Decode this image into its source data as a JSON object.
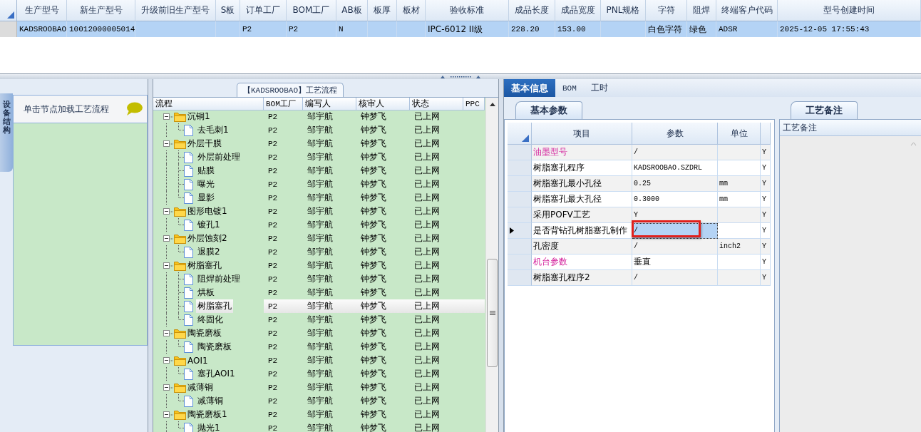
{
  "model_grid": {
    "columns": [
      "生产型号",
      "新生产型号",
      "升级前旧生产型号",
      "S板",
      "订单工厂",
      "BOM工厂",
      "AB板",
      "板厚",
      "板材",
      "验收标准",
      "成品长度",
      "成品宽度",
      "PNL规格",
      "字符",
      "阻焊",
      "终端客户代码",
      "型号创建时间"
    ],
    "rows": [
      {
        "selected": true,
        "cells": [
          "KADSROOBAO",
          "10012000005014",
          null,
          null,
          "P2",
          "P2",
          "N",
          null,
          null,
          "IPC-6012 II级",
          "228.20",
          "153.00",
          null,
          "白色字符",
          "绿色",
          "ADSR",
          "2025-12-05 17:55:43"
        ]
      }
    ]
  },
  "side_panel": {
    "vertical_tab": "设备结构",
    "hint": "单击节点加载工艺流程"
  },
  "flow_panel": {
    "title": "【KADSROOBAO】工艺流程",
    "columns": [
      "流程",
      "BOM工厂",
      "编写人",
      "核审人",
      "状态",
      "PPC"
    ],
    "steps": [
      {
        "kind": "folder",
        "name": "沉铜1",
        "bom": "P2",
        "writer": "邹宇航",
        "reviewer": "钟梦飞",
        "status": "已上网",
        "expanded": true,
        "selected": false,
        "children": [
          {
            "kind": "step",
            "name": "去毛刺1",
            "bom": "P2",
            "writer": "邹宇航",
            "reviewer": "钟梦飞",
            "status": "已上网",
            "selected": false
          }
        ]
      },
      {
        "kind": "folder",
        "name": "外层干膜",
        "bom": "P2",
        "writer": "邹宇航",
        "reviewer": "钟梦飞",
        "status": "已上网",
        "expanded": true,
        "selected": false,
        "children": [
          {
            "kind": "step",
            "name": "外层前处理",
            "bom": "P2",
            "writer": "邹宇航",
            "reviewer": "钟梦飞",
            "status": "已上网",
            "selected": false
          },
          {
            "kind": "step",
            "name": "贴膜",
            "bom": "P2",
            "writer": "邹宇航",
            "reviewer": "钟梦飞",
            "status": "已上网",
            "selected": false
          },
          {
            "kind": "step",
            "name": "曝光",
            "bom": "P2",
            "writer": "邹宇航",
            "reviewer": "钟梦飞",
            "status": "已上网",
            "selected": false
          },
          {
            "kind": "step",
            "name": "显影",
            "bom": "P2",
            "writer": "邹宇航",
            "reviewer": "钟梦飞",
            "status": "已上网",
            "selected": false
          }
        ]
      },
      {
        "kind": "folder",
        "name": "图形电镀1",
        "bom": "P2",
        "writer": "邹宇航",
        "reviewer": "钟梦飞",
        "status": "已上网",
        "expanded": true,
        "selected": false,
        "children": [
          {
            "kind": "step",
            "name": "镀孔1",
            "bom": "P2",
            "writer": "邹宇航",
            "reviewer": "钟梦飞",
            "status": "已上网",
            "selected": false
          }
        ]
      },
      {
        "kind": "folder",
        "name": "外层蚀刻2",
        "bom": "P2",
        "writer": "邹宇航",
        "reviewer": "钟梦飞",
        "status": "已上网",
        "expanded": true,
        "selected": false,
        "children": [
          {
            "kind": "step",
            "name": "退膜2",
            "bom": "P2",
            "writer": "邹宇航",
            "reviewer": "钟梦飞",
            "status": "已上网",
            "selected": false
          }
        ]
      },
      {
        "kind": "folder",
        "name": "树脂塞孔",
        "bom": "P2",
        "writer": "邹宇航",
        "reviewer": "钟梦飞",
        "status": "已上网",
        "expanded": true,
        "selected": false,
        "children": [
          {
            "kind": "step",
            "name": "阻焊前处理",
            "bom": "P2",
            "writer": "邹宇航",
            "reviewer": "钟梦飞",
            "status": "已上网",
            "selected": false
          },
          {
            "kind": "step",
            "name": "烘板",
            "bom": "P2",
            "writer": "邹宇航",
            "reviewer": "钟梦飞",
            "status": "已上网",
            "selected": false
          },
          {
            "kind": "step",
            "name": "树脂塞孔",
            "bom": "P2",
            "writer": "邹宇航",
            "reviewer": "钟梦飞",
            "status": "已上网",
            "selected": true
          },
          {
            "kind": "step",
            "name": "终固化",
            "bom": "P2",
            "writer": "邹宇航",
            "reviewer": "钟梦飞",
            "status": "已上网",
            "selected": false
          }
        ]
      },
      {
        "kind": "folder",
        "name": "陶瓷磨板",
        "bom": "P2",
        "writer": "邹宇航",
        "reviewer": "钟梦飞",
        "status": "已上网",
        "expanded": true,
        "selected": false,
        "children": [
          {
            "kind": "step",
            "name": "陶瓷磨板",
            "bom": "P2",
            "writer": "邹宇航",
            "reviewer": "钟梦飞",
            "status": "已上网",
            "selected": false
          }
        ]
      },
      {
        "kind": "folder",
        "name": "AOI1",
        "bom": "P2",
        "writer": "邹宇航",
        "reviewer": "钟梦飞",
        "status": "已上网",
        "expanded": true,
        "selected": false,
        "children": [
          {
            "kind": "step",
            "name": "塞孔AOI1",
            "bom": "P2",
            "writer": "邹宇航",
            "reviewer": "钟梦飞",
            "status": "已上网",
            "selected": false
          }
        ]
      },
      {
        "kind": "folder",
        "name": "减薄铜",
        "bom": "P2",
        "writer": "邹宇航",
        "reviewer": "钟梦飞",
        "status": "已上网",
        "expanded": true,
        "selected": false,
        "children": [
          {
            "kind": "step",
            "name": "减薄铜",
            "bom": "P2",
            "writer": "邹宇航",
            "reviewer": "钟梦飞",
            "status": "已上网",
            "selected": false
          }
        ]
      },
      {
        "kind": "folder",
        "name": "陶瓷磨板1",
        "bom": "P2",
        "writer": "邹宇航",
        "reviewer": "钟梦飞",
        "status": "已上网",
        "expanded": true,
        "selected": false,
        "children": [
          {
            "kind": "step",
            "name": "抛光1",
            "bom": "P2",
            "writer": "邹宇航",
            "reviewer": "钟梦飞",
            "status": "已上网",
            "selected": false
          }
        ]
      }
    ]
  },
  "detail": {
    "tabs": [
      {
        "label": "基本信息",
        "selected": true
      },
      {
        "label": "BOM",
        "selected": false
      },
      {
        "label": "工时",
        "selected": false
      }
    ],
    "params_tab": "基本参数",
    "params_columns": [
      "项目",
      "参数",
      "单位"
    ],
    "params": [
      {
        "kind": "group",
        "item": "油墨型号",
        "value": "/",
        "flag": "Y",
        "selected": false
      },
      {
        "kind": "param",
        "item": "树脂塞孔程序",
        "value": "KADSROOBAO.SZDRL",
        "flag": "Y",
        "selected": false
      },
      {
        "kind": "param",
        "item": "树脂塞孔最小孔径",
        "value": "0.25",
        "unit": "mm",
        "flag": "Y",
        "selected": false
      },
      {
        "kind": "param",
        "item": "树脂塞孔最大孔径",
        "value": "0.3000",
        "unit": "mm",
        "flag": "Y",
        "selected": false
      },
      {
        "kind": "param",
        "item": "采用POFV工艺",
        "value": "Y",
        "flag": "Y",
        "selected": false
      },
      {
        "kind": "param",
        "item": "是否背钻孔树脂塞孔制作",
        "value": "/",
        "flag": "Y",
        "selected": true
      },
      {
        "kind": "param",
        "item": "孔密度",
        "value": "/",
        "unit": "inch2",
        "flag": "Y",
        "selected": false
      },
      {
        "kind": "group",
        "item": "机台参数",
        "value": "垂直",
        "flag": "Y",
        "selected": false
      },
      {
        "kind": "param",
        "item": "树脂塞孔程序2",
        "value": "/",
        "flag": "Y",
        "selected": false
      }
    ],
    "notes_tab": "工艺备注",
    "notes_header": "工艺备注"
  }
}
